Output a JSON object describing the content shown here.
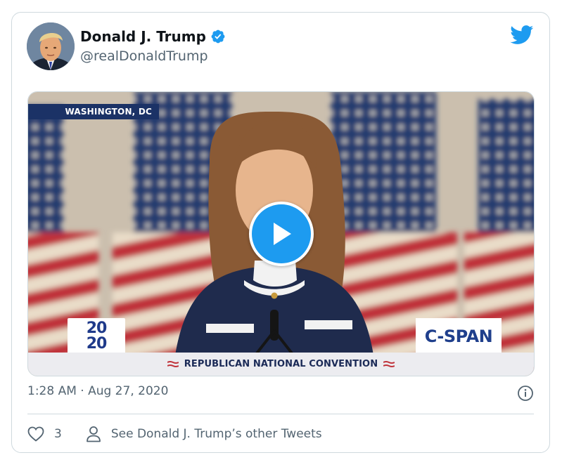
{
  "tweet": {
    "display_name": "Donald J. Trump",
    "handle": "@realDonaldTrump",
    "verified": true,
    "timestamp": "1:28 AM · Aug 27, 2020",
    "like_count": "3",
    "other_tweets_link": "See Donald J. Trump’s other Tweets"
  },
  "media": {
    "location_tag": "WASHINGTON, DC",
    "banner_text": "REPUBLICAN NATIONAL CONVENTION",
    "logo_2020_line1": "20",
    "logo_2020_line2": "20",
    "network_logo": "C-SPAN"
  },
  "icons": {
    "brand": "twitter-bird-icon",
    "verified": "verified-badge-icon",
    "play": "play-icon",
    "info": "info-icon",
    "like": "heart-icon",
    "profile": "person-icon"
  },
  "colors": {
    "accent": "#1d9bf0",
    "text_primary": "#0f1419",
    "text_secondary": "#536471",
    "border": "#cfd9de"
  }
}
